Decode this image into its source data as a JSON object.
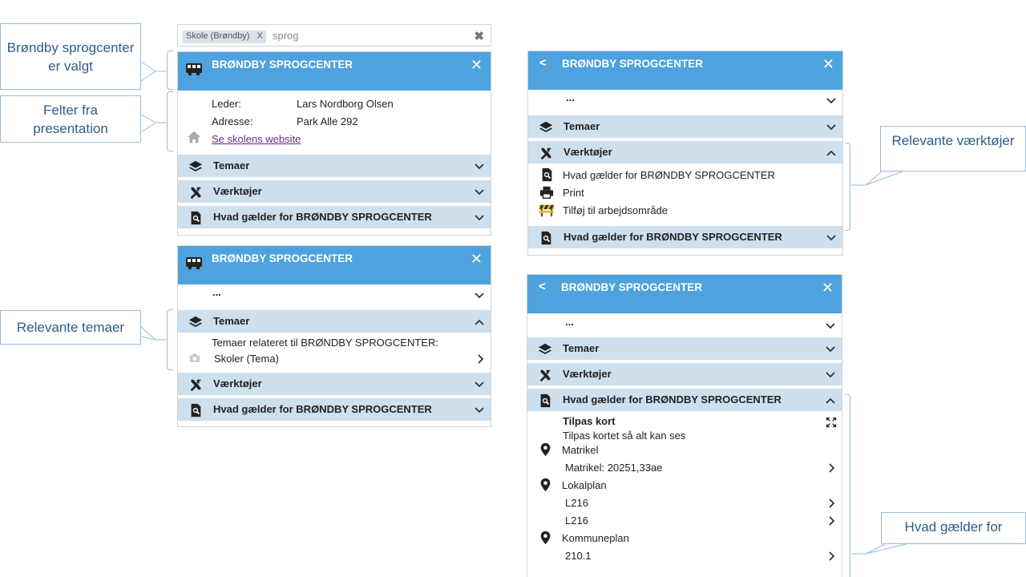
{
  "search": {
    "chip_label": "Skole (Brøndby)",
    "chip_remove": "X",
    "query": "sprog",
    "clear": "✖"
  },
  "callouts": {
    "selected": "Brøndby sprogcenter er valgt",
    "fields": "Felter fra presentation",
    "themes": "Relevante temaer",
    "tools": "Relevante værktøjer",
    "applies": "Hvad gælder for"
  },
  "panel1": {
    "title": "BRØNDBY SPROGCENTER",
    "close": "✕",
    "fields": [
      {
        "label": "Leder:",
        "value": "Lars Nordborg Olsen"
      },
      {
        "label": "Adresse:",
        "value": "Park Alle 292"
      }
    ],
    "website_link": "Se skolens website",
    "sections": [
      "Temaer",
      "Værktøjer",
      "Hvad gælder for BRØNDBY SPROGCENTER"
    ]
  },
  "panel2": {
    "title": "BRØNDBY SPROGCENTER",
    "close": "✕",
    "ellipsis": "...",
    "themes_section": "Temaer",
    "themes_text": "Temaer relateret til BRØNDBY SPROGCENTER:",
    "themes_item": "Skoler (Tema)",
    "tools_section": "Værktøjer",
    "applies_section": "Hvad gælder for BRØNDBY SPROGCENTER"
  },
  "panel3": {
    "back": "<",
    "title": "BRØNDBY SPROGCENTER",
    "close": "✕",
    "ellipsis": "...",
    "themes_section": "Temaer",
    "tools_section": "Værktøjer",
    "tools": [
      "Hvad gælder for BRØNDBY SPROGCENTER",
      "Print",
      "Tilføj til arbejdsområde"
    ],
    "applies_section": "Hvad gælder for BRØNDBY SPROGCENTER"
  },
  "panel4": {
    "back": "<",
    "title": "BRØNDBY SPROGCENTER",
    "close": "✕",
    "ellipsis": "...",
    "themes_section": "Temaer",
    "tools_section": "Værktøjer",
    "applies_section": "Hvad gælder for BRØNDBY SPROGCENTER",
    "fit_title": "Tilpas kort",
    "fit_desc": "Tilpas kortet så alt kan ses",
    "matrikel_label": "Matrikel",
    "matrikel_value": "Matrikel: 20251,33ae",
    "lokalplan_label": "Lokalplan",
    "lokalplan_values": [
      "L216",
      "L216"
    ],
    "kommuneplan_label": "Kommuneplan",
    "kommuneplan_value": "210.1"
  },
  "icons": {
    "bus": "bus-icon",
    "layers": "layers-icon",
    "tools": "tools-icon",
    "doc_search": "doc-search-icon",
    "home": "home-icon",
    "camera": "camera-icon",
    "print": "print-icon",
    "barrier": "barrier-icon",
    "pin": "map-pin-icon",
    "expand": "expand-icon"
  },
  "colors": {
    "header": "#4ea2dd",
    "section": "#cedfee",
    "callout_text": "#2e5c8a",
    "callout_border": "#9bbbd9",
    "link": "#6a2a86"
  }
}
